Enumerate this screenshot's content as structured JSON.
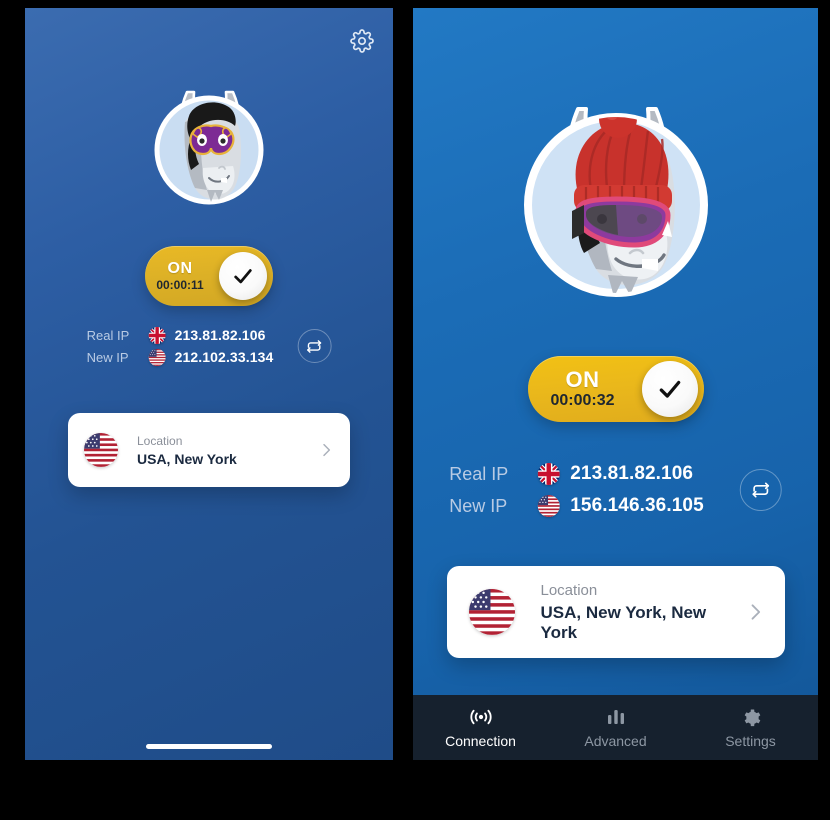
{
  "app": {
    "accent_yellow": "#e7b824",
    "left_panel_bg": "#2a5ca0",
    "right_panel_bg": "#1b6cb6",
    "nav_bg": "#16212e"
  },
  "left_screen": {
    "settings_icon": "gear-icon",
    "avatar": "donkey-masquerade-mask-avatar",
    "toggle": {
      "state_label": "ON",
      "timer": "00:00:11",
      "knob_icon": "check-icon"
    },
    "real_ip": {
      "label": "Real IP",
      "flag": "uk-flag",
      "value": "213.81.82.106"
    },
    "new_ip": {
      "label": "New IP",
      "flag": "usa-flag",
      "value": "212.102.33.134"
    },
    "refresh_icon": "refresh-ip-icon",
    "location_card": {
      "flag": "usa-flag",
      "caption": "Location",
      "value": "USA, New York",
      "chevron_icon": "chevron-right-icon"
    }
  },
  "right_screen": {
    "avatar": "donkey-beanie-goggles-avatar",
    "toggle": {
      "state_label": "ON",
      "timer": "00:00:32",
      "knob_icon": "check-icon"
    },
    "real_ip": {
      "label": "Real IP",
      "flag": "uk-flag",
      "value": "213.81.82.106"
    },
    "new_ip": {
      "label": "New IP",
      "flag": "usa-flag",
      "value": "156.146.36.105"
    },
    "refresh_icon": "refresh-ip-icon",
    "location_card": {
      "flag": "usa-flag",
      "caption": "Location",
      "value": "USA, New York, New York",
      "chevron_icon": "chevron-right-icon"
    },
    "bottom_nav": {
      "items": [
        {
          "label": "Connection",
          "icon": "broadcast-icon",
          "active": true
        },
        {
          "label": "Advanced",
          "icon": "bar-chart-icon",
          "active": false
        },
        {
          "label": "Settings",
          "icon": "gear-filled-icon",
          "active": false
        }
      ]
    }
  }
}
